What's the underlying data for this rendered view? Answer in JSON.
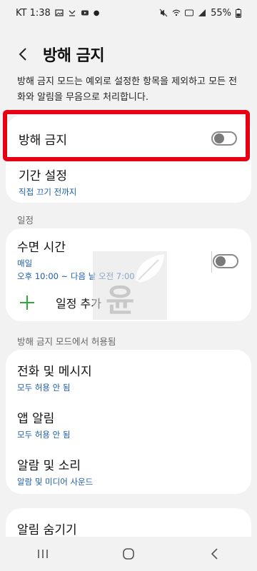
{
  "status_bar": {
    "carrier_time": "KT 1:38",
    "battery": "55%"
  },
  "header": {
    "title": "방해 금지"
  },
  "description": "방해 금지 모드는 예외로 설정한 항목을 제외하고 모든 전화와 알림을 무음으로 처리합니다.",
  "dnd": {
    "label": "방해 금지",
    "enabled": false
  },
  "period": {
    "label": "기간 설정",
    "value": "직접 끄기 전까지"
  },
  "schedule_section": {
    "label": "일정",
    "sleep": {
      "title": "수면 시간",
      "days": "매일",
      "time": "오후 10:00 ~ 다음 날 오전 7:00",
      "enabled": false
    },
    "add_label": "일정 추가"
  },
  "allowed_section": {
    "label": "방해 금지 모드에서 허용됨",
    "items": [
      {
        "title": "전화 및 메시지",
        "value": "모두 허용 안 됨"
      },
      {
        "title": "앱 알림",
        "value": "모두 허용 안 됨"
      },
      {
        "title": "알람 및 소리",
        "value": "알람 및 미디어 사운드"
      }
    ]
  },
  "hide": {
    "title": "알림 숨기기"
  },
  "colors": {
    "accent_blue": "#1a5ea8",
    "highlight_red": "#e60012",
    "plus_green": "#2eaa3a"
  }
}
